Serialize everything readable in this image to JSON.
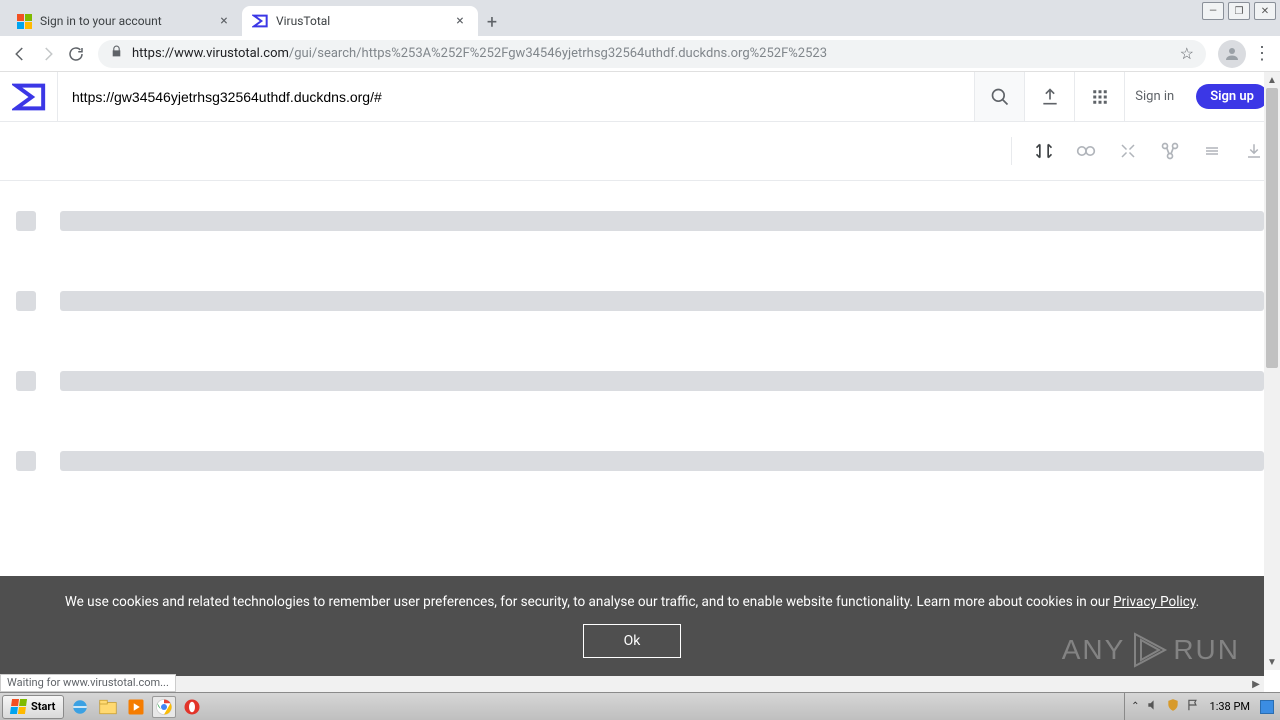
{
  "browser": {
    "tabs": [
      {
        "title": "Sign in to your account",
        "active": false
      },
      {
        "title": "VirusTotal",
        "active": true
      }
    ],
    "url_scheme_host": "https://www.virustotal.com",
    "url_path": "/gui/search/https%253A%252F%252Fgw34546yjetrhsg32564uthdf.duckdns.org%252F%2523",
    "status_text": "Waiting for www.virustotal.com..."
  },
  "vt": {
    "search_value": "https://gw34546yjetrhsg32564uthdf.duckdns.org/#",
    "signin": "Sign in",
    "signup": "Sign up"
  },
  "cookie": {
    "text_before": "We use cookies and related technologies to remember user preferences, for security, to analyse our traffic, and to enable website functionality. Learn more about cookies in our ",
    "link": "Privacy Policy",
    "text_after": ".",
    "ok": "Ok"
  },
  "watermark": {
    "a": "ANY",
    "b": "RUN"
  },
  "taskbar": {
    "start": "Start",
    "clock": "1:38 PM"
  }
}
